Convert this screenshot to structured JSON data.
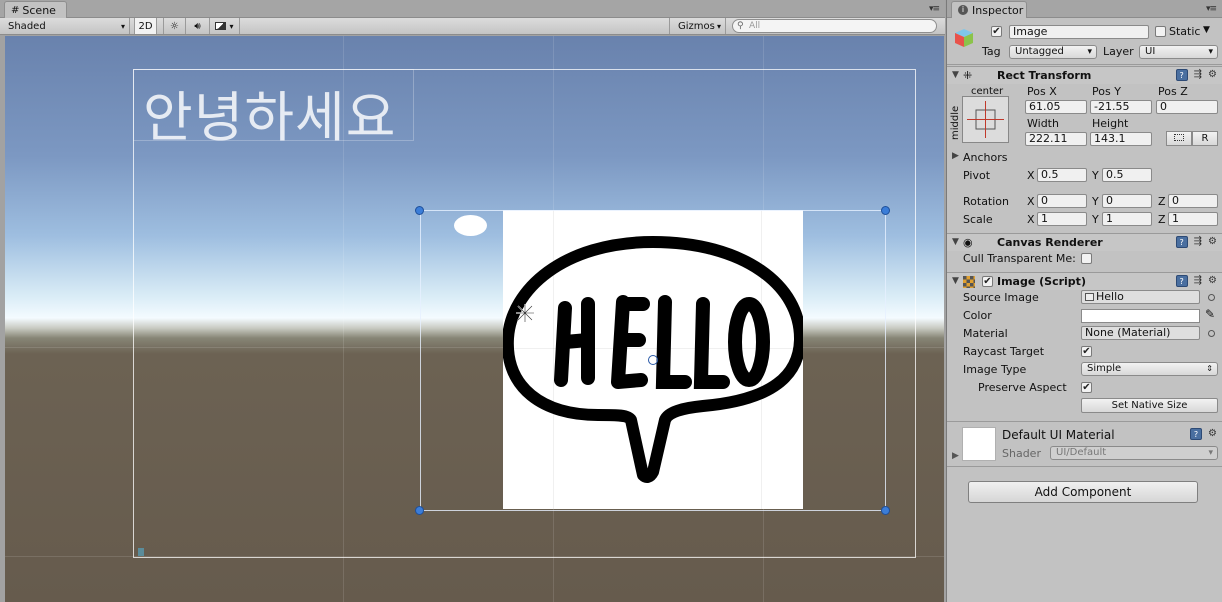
{
  "scene": {
    "tab_label": "Scene",
    "shading": "Shaded",
    "mode_2d": "2D",
    "gizmos": "Gizmos",
    "search_placeholder": "All",
    "ui_text": "안녕하세요"
  },
  "inspector": {
    "tab_label": "Inspector",
    "object_name": "Image",
    "static_label": "Static",
    "tag_label": "Tag",
    "tag_value": "Untagged",
    "layer_label": "Layer",
    "layer_value": "UI",
    "rect_transform": {
      "title": "Rect Transform",
      "anchor_h": "center",
      "anchor_v": "middle",
      "pos_x_label": "Pos X",
      "pos_x": "61.05",
      "pos_y_label": "Pos Y",
      "pos_y": "-21.55",
      "pos_z_label": "Pos Z",
      "pos_z": "0",
      "width_label": "Width",
      "width": "222.11",
      "height_label": "Height",
      "height": "143.1",
      "r_button": "R",
      "anchors_label": "Anchors",
      "pivot_label": "Pivot",
      "pivot_x": "0.5",
      "pivot_y": "0.5",
      "rotation_label": "Rotation",
      "rot_x": "0",
      "rot_y": "0",
      "rot_z": "0",
      "scale_label": "Scale",
      "scale_x": "1",
      "scale_y": "1",
      "scale_z": "1",
      "x": "X",
      "y": "Y",
      "z": "Z"
    },
    "canvas_renderer": {
      "title": "Canvas Renderer",
      "cull_label": "Cull Transparent Me:"
    },
    "image_script": {
      "title": "Image (Script)",
      "source_image_label": "Source Image",
      "source_image": "Hello",
      "color_label": "Color",
      "material_label": "Material",
      "material": "None (Material)",
      "raycast_label": "Raycast Target",
      "image_type_label": "Image Type",
      "image_type": "Simple",
      "preserve_label": "Preserve Aspect",
      "native_size_button": "Set Native Size"
    },
    "material_section": {
      "name": "Default UI Material",
      "shader_label": "Shader",
      "shader": "UI/Default"
    },
    "add_component": "Add Component"
  }
}
